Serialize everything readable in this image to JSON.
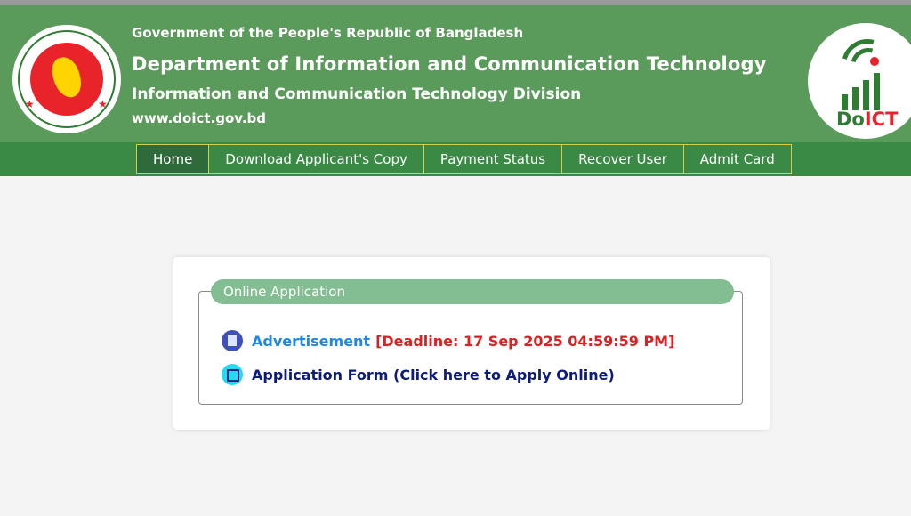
{
  "header": {
    "line1": "Government of the People's Republic of Bangladesh",
    "line2": "Department of Information and Communication Technology",
    "line3": "Information and Communication Technology Division",
    "line4": "www.doict.gov.bd",
    "logo_text_a": "Do",
    "logo_text_b": "ICT",
    "colors": {
      "header_bg": "#5a9a5a",
      "nav_bg": "#3a8a45",
      "accent_red": "#e8232a"
    }
  },
  "nav": {
    "items": [
      {
        "label": "Home"
      },
      {
        "label": "Download Applicant's Copy"
      },
      {
        "label": "Payment Status"
      },
      {
        "label": "Recover User"
      },
      {
        "label": "Admit Card"
      }
    ]
  },
  "panel": {
    "title": "Online Application",
    "advertisement": "Advertisement",
    "deadline": "[Deadline: 17 Sep 2025 04:59:59 PM]",
    "application_form": "Application Form (Click here to Apply Online)"
  }
}
